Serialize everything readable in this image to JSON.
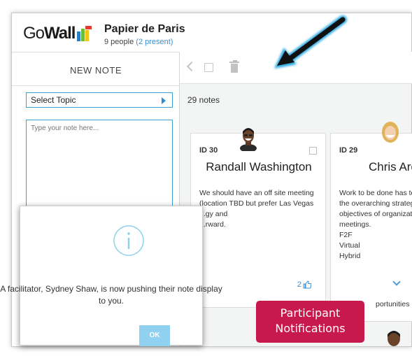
{
  "app": {
    "logo_text_plain": "Go",
    "logo_text_bold": "Wall",
    "logo_icon": "gowall-logo-icon",
    "brand_colors": {
      "green": "#6abf3a",
      "red": "#e23a2c",
      "blue": "#2a7fc1",
      "yellow": "#f2c318"
    }
  },
  "board": {
    "title": "Papier de Paris",
    "people_label": "9 people",
    "present_label": "(2 present)"
  },
  "new_note": {
    "title": "NEW NOTE",
    "select_topic_label": "Select Topic",
    "textarea_placeholder": "Type your note here..."
  },
  "toolbar": {
    "back_icon": "chevron-left-icon",
    "select_icon": "square-icon",
    "delete_icon": "trash-icon"
  },
  "notes": {
    "count_label": "29 notes",
    "cards": [
      {
        "id": "ID 30",
        "author": "Randall Washington",
        "body": [
          "We should have an off site meeting",
          "(location TBD but prefer Las Vegas",
          "...gy and",
          "...rward."
        ],
        "likes": "2"
      },
      {
        "id": "ID 29",
        "author": "Chris Ard",
        "body": [
          "Work to be done has to",
          "the overarching strategy",
          "objectives of organizati",
          "meetings.",
          "F2F",
          "Virtual",
          "Hybrid"
        ],
        "footer": "portunities"
      }
    ]
  },
  "modal": {
    "message": "A facilitator, Sydney Shaw, is now pushing their note display to you.",
    "ok_label": "OK",
    "accent": "#8fd1ef"
  },
  "callout": {
    "line1": "Participant",
    "line2": "Notifications",
    "color": "#c8194d"
  },
  "annotation_arrow": {
    "color": "#2aa8e0"
  }
}
